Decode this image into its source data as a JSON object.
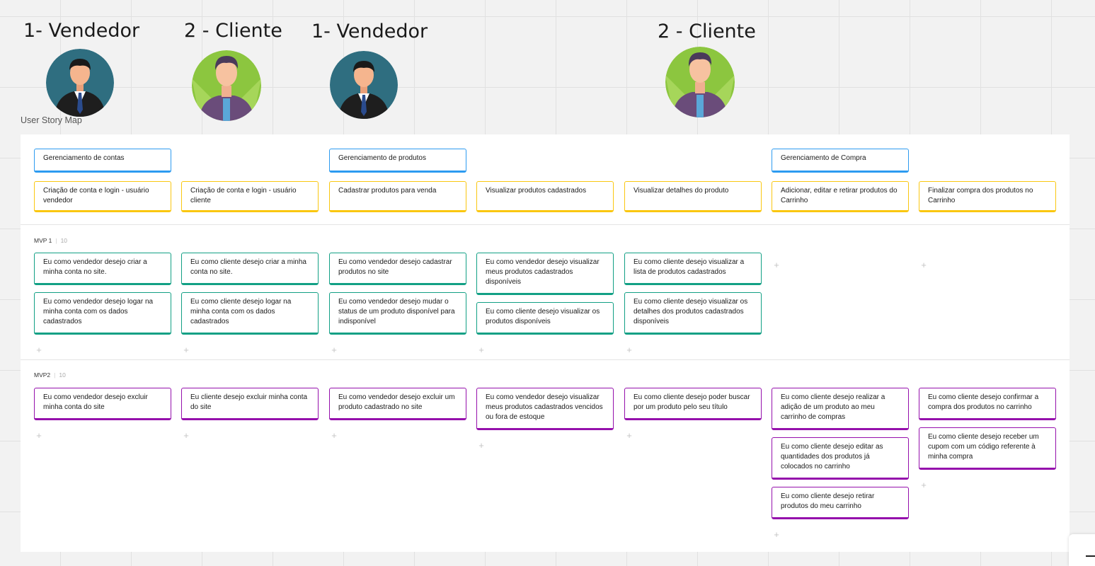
{
  "personas": [
    {
      "label": "1- Vendedor",
      "kind": "seller"
    },
    {
      "label": "2 - Cliente",
      "kind": "client"
    },
    {
      "label": "1- Vendedor",
      "kind": "seller"
    },
    {
      "label": "2 - Cliente",
      "kind": "client"
    }
  ],
  "board_title": "User Story Map",
  "activities": [
    {
      "col": 0,
      "text": "Gerenciamento de contas"
    },
    {
      "col": 2,
      "text": "Gerenciamento de produtos"
    },
    {
      "col": 5,
      "text": "Gerenciamento de Compra"
    }
  ],
  "steps": [
    "Criação de conta e login - usuário vendedor",
    "Criação de conta e login - usuário cliente",
    "Cadastrar produtos para venda",
    "Visualizar produtos cadastrados",
    "Visualizar detalhes do produto",
    "Adicionar, editar e retirar produtos do Carrinho",
    "Finalizar compra dos produtos no Carrinho"
  ],
  "releases": [
    {
      "name": "MVP 1",
      "count": "10",
      "columns": [
        [
          "Eu como vendedor desejo criar a minha conta no site.",
          "Eu como vendedor desejo logar na minha conta com os dados cadastrados"
        ],
        [
          "Eu como cliente desejo criar a minha conta no site.",
          "Eu como cliente desejo logar na minha conta com os dados cadastrados"
        ],
        [
          "Eu como vendedor desejo cadastrar produtos no site",
          "Eu como vendedor desejo mudar o status de um produto disponível para indisponível"
        ],
        [
          "Eu como vendedor desejo visualizar meus produtos cadastrados disponíveis",
          "Eu como cliente desejo visualizar os produtos disponíveis"
        ],
        [
          "Eu como cliente desejo visualizar a lista de produtos cadastrados",
          "Eu como cliente desejo visualizar os detalhes dos produtos cadastrados disponíveis"
        ],
        [],
        []
      ]
    },
    {
      "name": "MVP2",
      "count": "10",
      "columns": [
        [
          "Eu como vendedor desejo excluir minha conta do site"
        ],
        [
          "Eu cliente desejo excluir minha conta do site"
        ],
        [
          "Eu como vendedor desejo excluir um produto cadastrado no site"
        ],
        [
          "Eu como vendedor desejo visualizar meus produtos cadastrados vencidos ou fora de estoque"
        ],
        [
          "Eu como cliente desejo poder buscar por um produto pelo seu título"
        ],
        [
          "Eu como cliente desejo realizar a adição de um produto ao meu carrinho de compras",
          "Eu como cliente desejo editar as quantidades dos produtos já colocados no carrinho",
          "Eu como cliente desejo retirar produtos do meu carrinho"
        ],
        [
          "Eu como cliente desejo confirmar a compra dos produtos no carrinho",
          "Eu como cliente desejo receber um cupom com um código referente à minha compra"
        ]
      ]
    }
  ],
  "add_symbol": "+",
  "zoom_minus": "−",
  "colors": {
    "activity": "#2d9bf0",
    "step": "#fac710",
    "mvp1": "#12a085",
    "mvp2": "#9510ac",
    "seller_bg": "#2f6e80",
    "client_bg": "#8cc63f"
  }
}
